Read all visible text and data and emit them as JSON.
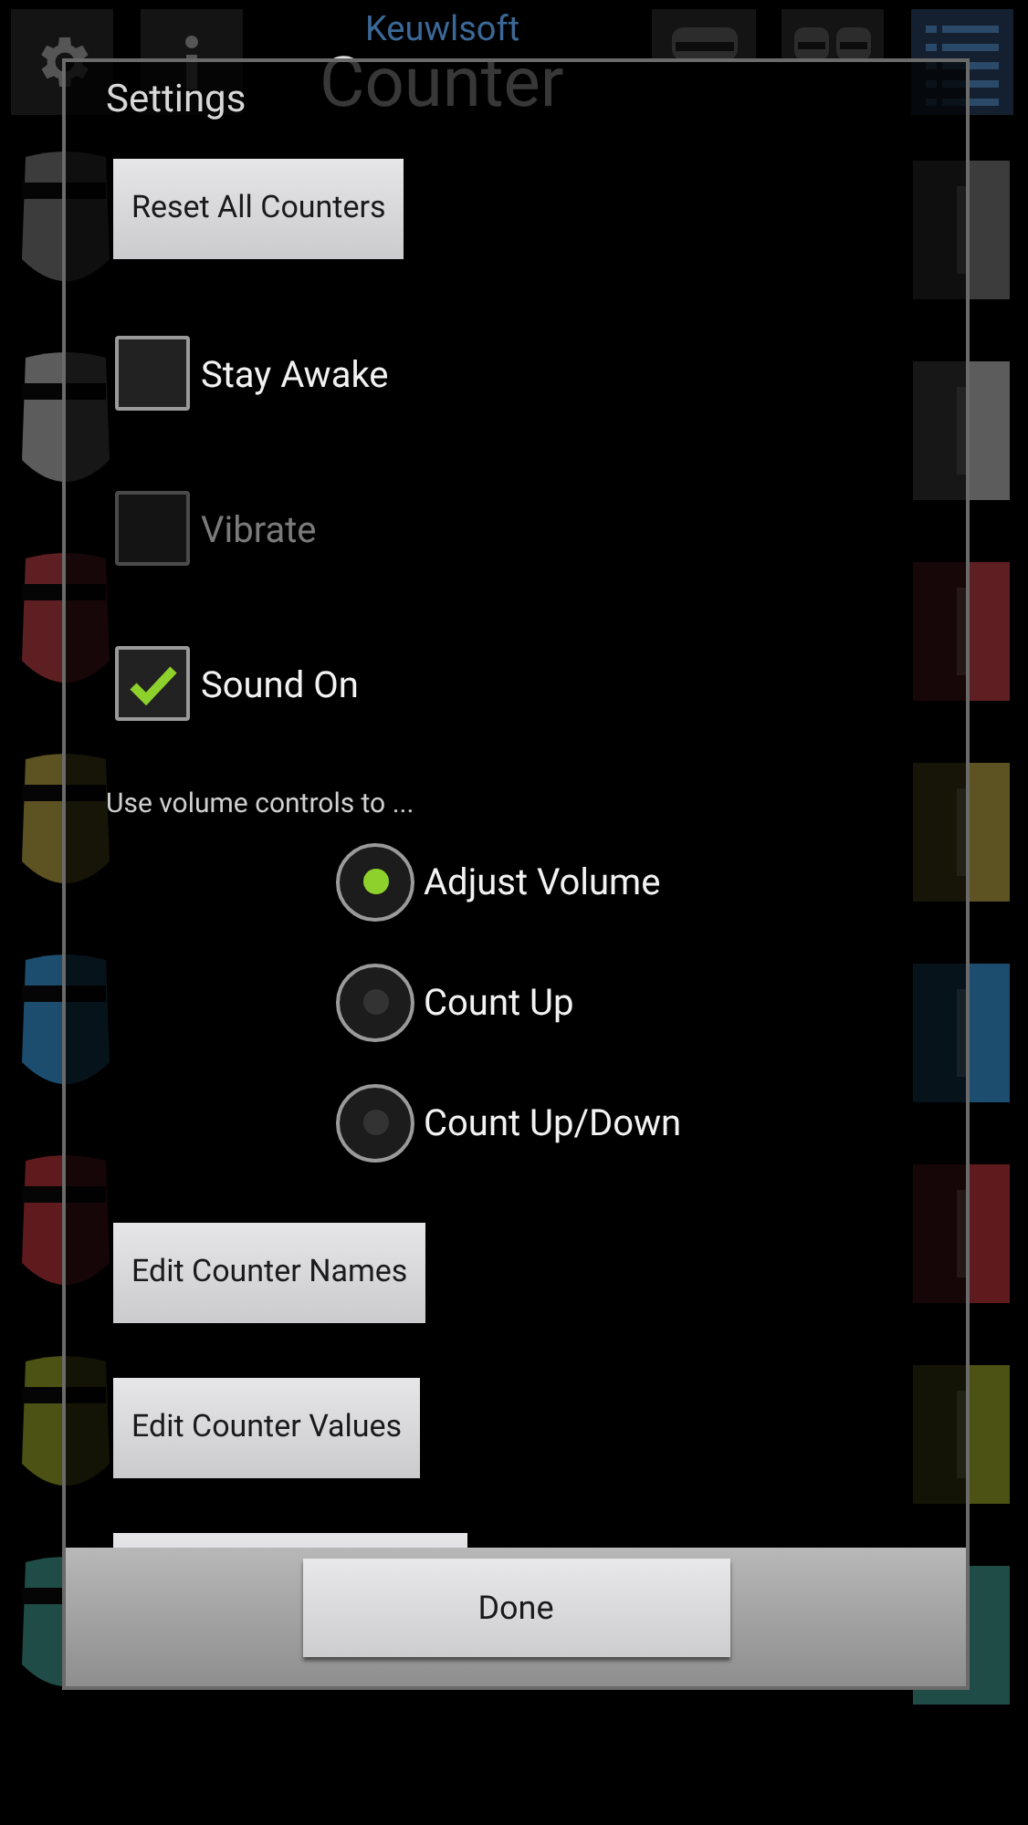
{
  "app": {
    "brand": "Keuwlsoft",
    "title": "Counter",
    "counters": [
      {
        "color": "#3c3c3c"
      },
      {
        "color": "#5c5c5c"
      },
      {
        "color": "#5e1f22"
      },
      {
        "color": "#5c5222"
      },
      {
        "color": "#1d4d6e"
      },
      {
        "color": "#5e1a1c"
      },
      {
        "color": "#4c5214"
      },
      {
        "color": "#1f4c46"
      }
    ]
  },
  "dialog": {
    "title": "Settings",
    "items": [
      {
        "kind": "button",
        "label": "Reset All Counters"
      },
      {
        "kind": "checkbox",
        "label": "Stay Awake",
        "checked": false,
        "disabled": false
      },
      {
        "kind": "checkbox",
        "label": "Vibrate",
        "checked": false,
        "disabled": true
      },
      {
        "kind": "checkbox",
        "label": "Sound On",
        "checked": true,
        "disabled": false
      },
      {
        "kind": "caption",
        "label": "Use volume controls to ..."
      },
      {
        "kind": "radio",
        "label": "Adjust Volume",
        "selected": true
      },
      {
        "kind": "radio",
        "label": "Count Up",
        "selected": false
      },
      {
        "kind": "radio",
        "label": "Count Up/Down",
        "selected": false
      },
      {
        "kind": "button",
        "label": "Edit Counter Names"
      },
      {
        "kind": "button",
        "label": "Edit Counter Values"
      },
      {
        "kind": "partial_button"
      }
    ],
    "done": "Done"
  }
}
